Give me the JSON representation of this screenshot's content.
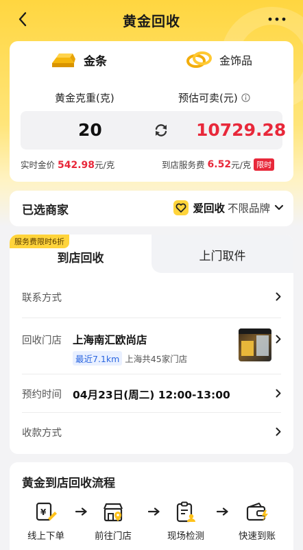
{
  "nav": {
    "title": "黄金回收"
  },
  "material_tabs": [
    {
      "label": "金条",
      "active": true
    },
    {
      "label": "金饰品",
      "active": false
    }
  ],
  "calculator": {
    "weight_label": "黄金克重(克)",
    "estimate_label": "预估可卖(元)",
    "weight_value": "20",
    "estimate_value": "10729.28",
    "realtime_label": "实时金价",
    "realtime_price": "542.98",
    "realtime_unit": "元/克",
    "service_label": "到店服务费",
    "service_fee": "6.52",
    "service_unit": "元/克",
    "limited_badge": "限时",
    "price_color": "#e8283a"
  },
  "merchant": {
    "title": "已选商家",
    "name": "爱回收",
    "sub": "不限品牌"
  },
  "service": {
    "promo_badge": "服务费限时6折",
    "tabs": [
      {
        "label": "到店回收",
        "active": true
      },
      {
        "label": "上门取件",
        "active": false
      }
    ],
    "rows": {
      "contact_label": "联系方式",
      "store_label": "回收门店",
      "store_name": "上海南汇欧尚店",
      "distance": "最近7.1km",
      "store_count": "上海共45家门店",
      "time_label": "预约时间",
      "time_value": "04月23日(周二) 12:00-13:00",
      "payment_label": "收款方式"
    }
  },
  "flow": {
    "title": "黄金到店回收流程",
    "steps": [
      {
        "label": "线上下单",
        "icon": "order-icon"
      },
      {
        "label": "前往门店",
        "icon": "store-location-icon"
      },
      {
        "label": "现场检测",
        "icon": "inspection-icon"
      },
      {
        "label": "快速到账",
        "icon": "wallet-icon"
      }
    ]
  },
  "colors": {
    "brand_yellow": "#ffd43b",
    "accent_red": "#e8283a"
  }
}
